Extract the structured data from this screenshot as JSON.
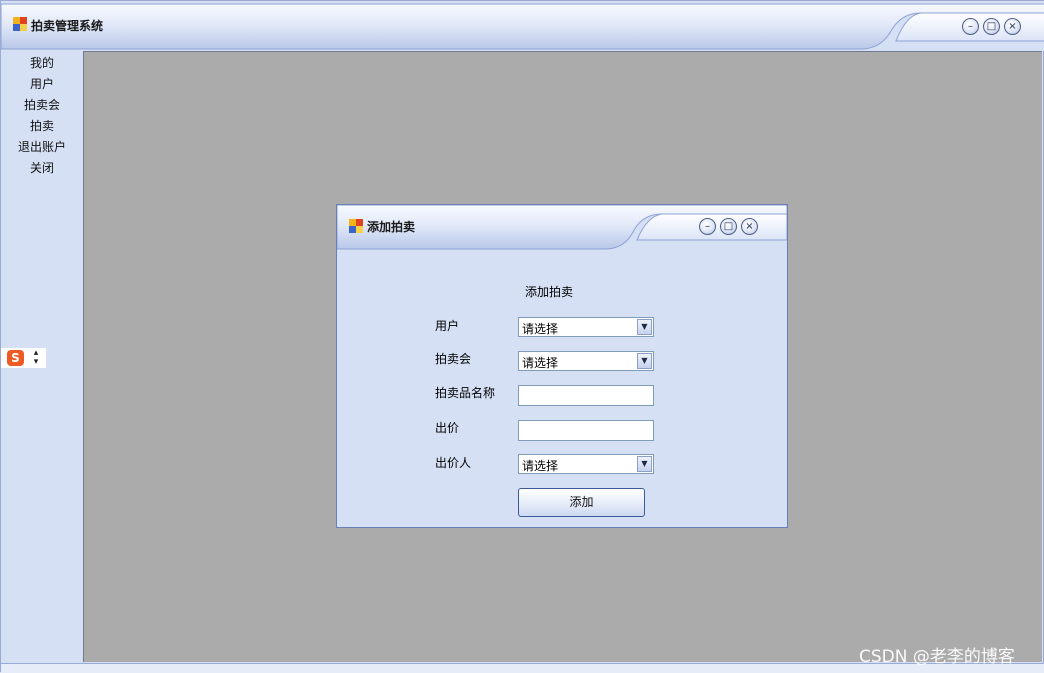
{
  "main_window": {
    "title": "拍卖管理系统",
    "controls": {
      "minimize": "minimize-icon",
      "maximize": "maximize-icon",
      "close": "close-icon"
    }
  },
  "sidebar": {
    "items": [
      {
        "label": "我的"
      },
      {
        "label": "用户"
      },
      {
        "label": "拍卖会"
      },
      {
        "label": "拍卖"
      },
      {
        "label": "退出账户"
      },
      {
        "label": "关闭"
      }
    ]
  },
  "ime": {
    "logo": "S",
    "arrows_up": "▴",
    "arrows_down": "▾"
  },
  "dialog": {
    "title": "添加拍卖",
    "heading": "添加拍卖",
    "fields": {
      "user": {
        "label": "用户",
        "value": "请选择"
      },
      "auction_event": {
        "label": "拍卖会",
        "value": "请选择"
      },
      "item_name": {
        "label": "拍卖品名称",
        "value": ""
      },
      "bid": {
        "label": "出价",
        "value": ""
      },
      "bidder": {
        "label": "出价人",
        "value": "请选择"
      }
    },
    "add_button": "添加"
  },
  "watermark": "CSDN @老李的博客",
  "colors": {
    "window_bg": "#d6e0f5",
    "mdi_bg": "#ababab",
    "border": "#6a7fb5",
    "ime_logo": "#ee5a24"
  }
}
